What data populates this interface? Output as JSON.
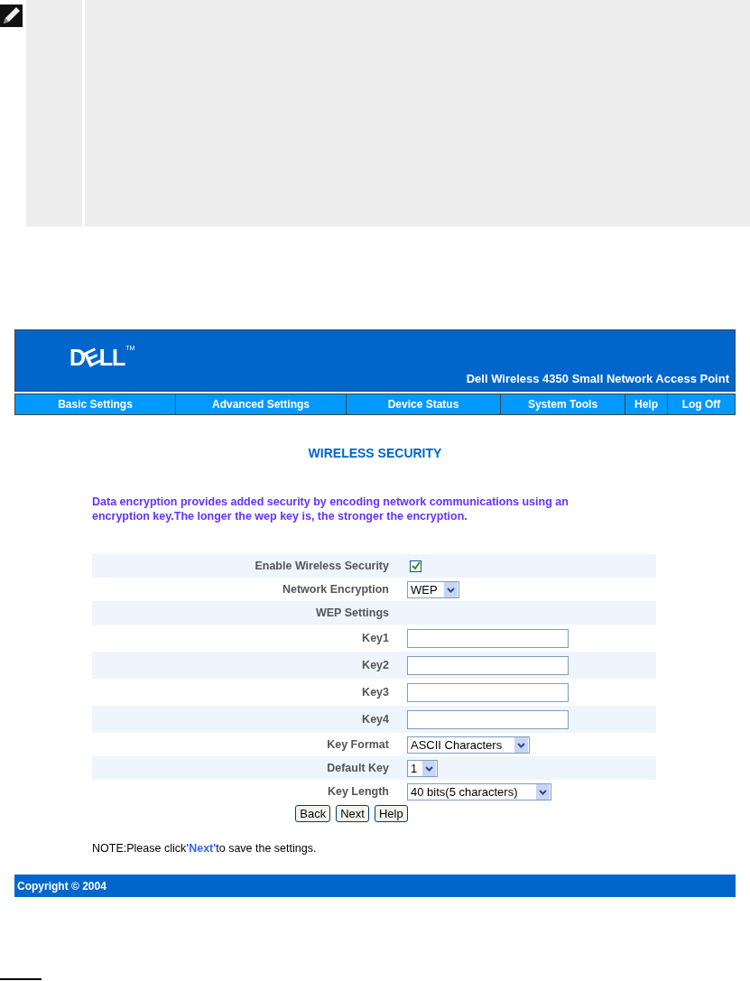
{
  "note_box": {
    "kind": "note"
  },
  "header": {
    "logo": "DELL",
    "trademark": "TM",
    "product": "Dell Wireless 4350 Small Network Access Point"
  },
  "nav": [
    "Basic Settings",
    "Advanced Settings",
    "Device Status",
    "System Tools",
    "Help",
    "Log Off"
  ],
  "title": "WIRELESS SECURITY",
  "intro": "Data encryption provides added security by encoding network communications using an encryption key.The longer the wep key is, the stronger the encryption.",
  "form": [
    {
      "kind": "checkbox",
      "label": "Enable Wireless Security",
      "checked": true
    },
    {
      "kind": "select",
      "label": "Network Encryption",
      "value": "WEP"
    },
    {
      "kind": "heading",
      "label": "WEP Settings"
    },
    {
      "kind": "text",
      "label": "Key1"
    },
    {
      "kind": "text",
      "label": "Key2"
    },
    {
      "kind": "text",
      "label": "Key3"
    },
    {
      "kind": "text",
      "label": "Key4"
    },
    {
      "kind": "select",
      "label": "Key Format",
      "value": "ASCII Characters"
    },
    {
      "kind": "select",
      "label": "Default Key",
      "value": "1"
    },
    {
      "kind": "select",
      "label": "Key Length",
      "value": "40 bits(5 characters)"
    }
  ],
  "buttons": [
    "Back",
    "Next",
    "Help"
  ],
  "note": {
    "before": "NOTE:Please click",
    "highlight": "'Next'",
    "after": "to save the settings."
  },
  "footer": "Copyright © 2004"
}
